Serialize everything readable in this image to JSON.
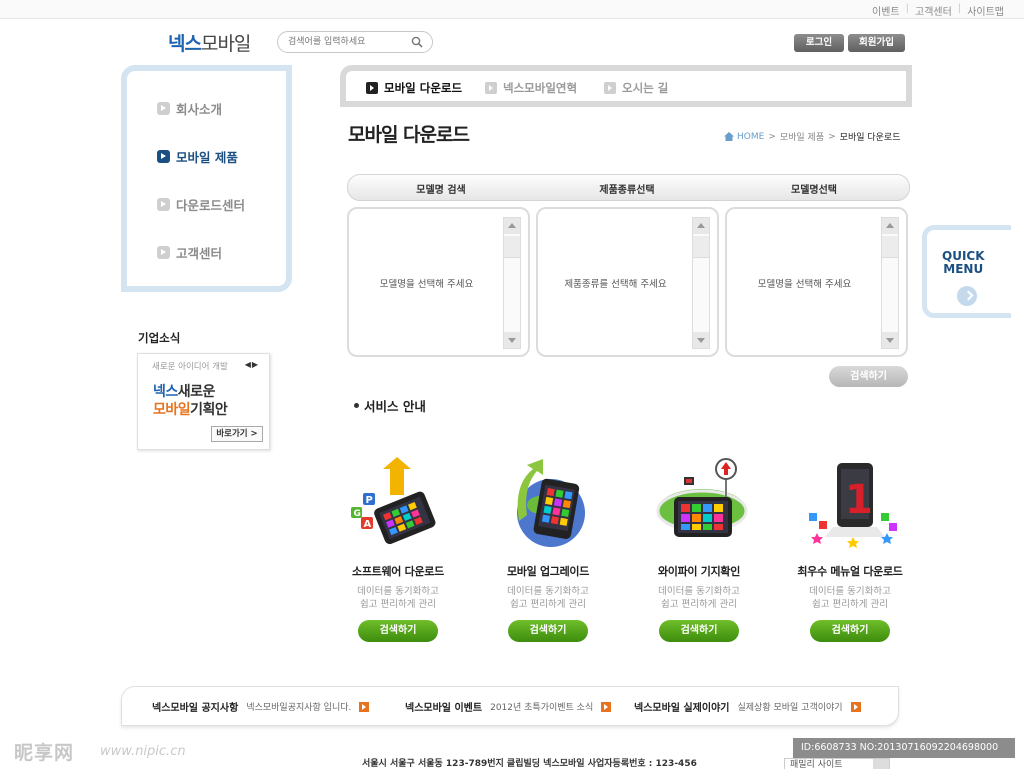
{
  "top_links": [
    "이벤트",
    "고객센터",
    "사이트맵"
  ],
  "logo": {
    "part1": "넥스",
    "part2": "모바일"
  },
  "search": {
    "placeholder": "검색어를 입력하세요"
  },
  "header_buttons": {
    "login": "로그인",
    "join": "회원가입"
  },
  "sidebar": {
    "items": [
      {
        "label": "회사소개",
        "active": false
      },
      {
        "label": "모바일 제품",
        "active": true
      },
      {
        "label": "다운로드센터",
        "active": false
      },
      {
        "label": "고객센터",
        "active": false
      }
    ]
  },
  "news": {
    "title": "기업소식",
    "small": "새로운 아이디어 개발",
    "arrows": "◀▶",
    "line1_a": "넥스",
    "line1_b": "새로운",
    "line2_a": "모바일",
    "line2_b": "기획안",
    "more": "바로가기 >"
  },
  "tabs": [
    {
      "label": "모바일 다운로드",
      "active": true
    },
    {
      "label": "넥스모바일연혁",
      "active": false
    },
    {
      "label": "오시는 길",
      "active": false
    }
  ],
  "page_title": "모바일 다운로드",
  "breadcrumb": {
    "home": "HOME",
    "sep": ">",
    "mid": "모바일 제품",
    "current": "모바일 다운로드"
  },
  "selector": {
    "headers": [
      "모델명 검색",
      "제품종류선택",
      "모델명선택"
    ],
    "boxes": [
      "모델명을 선택해 주세요",
      "제품종류를 선택해 주세요",
      "모델명을 선택해 주세요"
    ],
    "search_button": "검색하기"
  },
  "quick": {
    "line1": "QUICK",
    "line2": "MENU"
  },
  "services": {
    "title": "서비스 안내",
    "items": [
      {
        "name": "소프트웨어 다운로드",
        "desc1": "데이터를 동기화하고",
        "desc2": "쉽고 편리하게 관리",
        "button": "검색하기",
        "icon": "phone-upload-icon"
      },
      {
        "name": "모바일 업그레이드",
        "desc1": "데이터를 동기화하고",
        "desc2": "쉽고 편리하게 관리",
        "button": "검색하기",
        "icon": "phone-upgrade-icon"
      },
      {
        "name": "와이파이 기지확인",
        "desc1": "데이터를 동기화하고",
        "desc2": "쉽고 편리하게 관리",
        "button": "검색하기",
        "icon": "wifi-station-icon"
      },
      {
        "name": "최우수 메뉴얼 다운로드",
        "desc1": "데이터를 동기화하고",
        "desc2": "쉽고 편리하게 관리",
        "button": "검색하기",
        "icon": "manual-rank-icon"
      }
    ]
  },
  "notice": [
    {
      "title": "넥스모바일 공지사항",
      "desc": "넥스모바일공지사항 입니다."
    },
    {
      "title": "넥스모바일 이벤트",
      "desc": "2012년 초특가이벤트 소식"
    },
    {
      "title": "넥스모바일 실제이야기",
      "desc": "실제상황 모바일 고객이야기"
    }
  ],
  "address": "서울시 서울구 서울동 123-789번지 클립빌딩 넥스모바일 사업자등록번호 : 123-456",
  "family_site": "패밀리 사이트",
  "watermark": {
    "left": "昵享网",
    "url": "www.nipic.cn",
    "id": "ID:6608733 NO:20130716092204698000"
  },
  "colors": {
    "brand_blue": "#1c4f82",
    "accent_orange": "#e8731e",
    "green_button": "#4ba318",
    "frame_blue": "#d5e4f1"
  }
}
